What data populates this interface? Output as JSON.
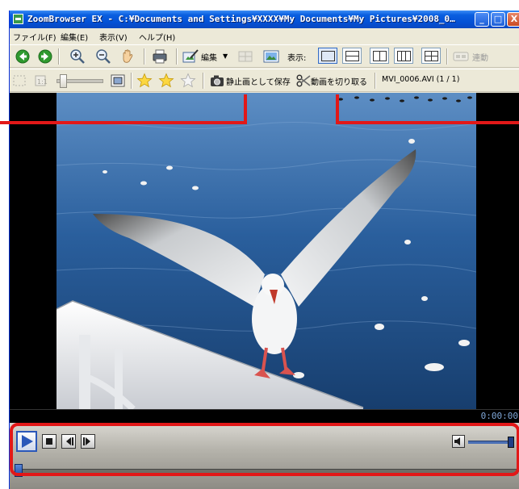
{
  "window": {
    "title": "ZoomBrowser EX - C:¥Documents and Settings¥XXXX¥My Documents¥My Pictures¥2008_0…",
    "minimize_label": "_",
    "maximize_label": "□",
    "close_label": "X"
  },
  "menu": {
    "file": "ファイル(F)",
    "edit": "編集(E)",
    "view": "表示(V)",
    "help": "ヘルプ(H)"
  },
  "toolbar1": {
    "edit_label": "編集",
    "view_label": "表示:",
    "sync_label": "連動"
  },
  "toolbar2": {
    "save_still_label": "静止画として保存",
    "cut_movie_label": "動画を切り取る",
    "file_info": "MVI_0006.AVI (1 / 1)"
  },
  "player": {
    "time_display": "0:00:00",
    "seek_position": 0.0,
    "volume_level": 0.98
  },
  "colors": {
    "titlebar": "#0450d4",
    "highlight": "#e21818",
    "window_bg": "#ece9d8"
  },
  "icons": [
    "back-icon",
    "forward-icon",
    "zoom-in-icon",
    "zoom-out-icon",
    "hand-icon",
    "printer-icon",
    "edit-icon",
    "slideshow-icon",
    "star-icon",
    "camera-icon",
    "scissors-icon",
    "play-icon",
    "stop-icon",
    "frame-back-icon",
    "frame-forward-icon",
    "speaker-icon"
  ]
}
